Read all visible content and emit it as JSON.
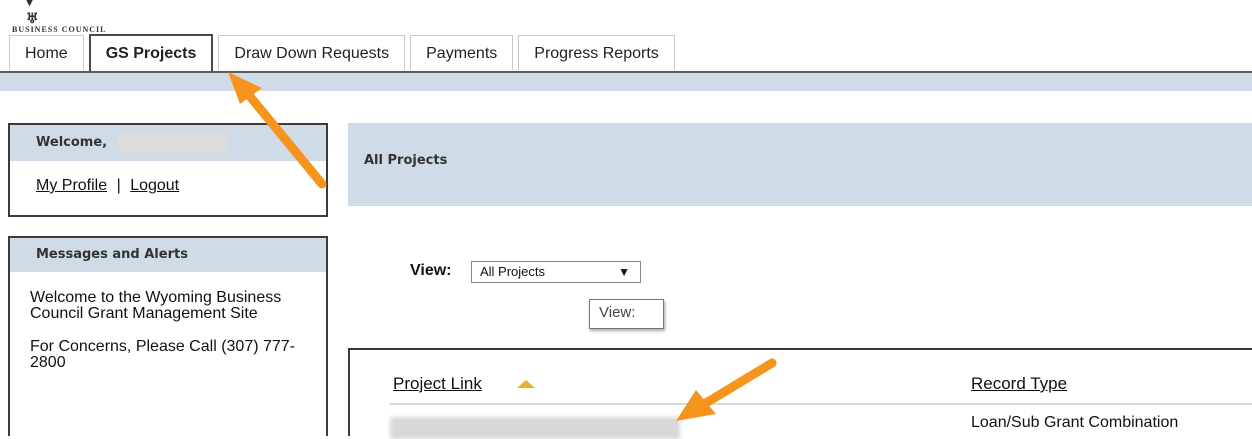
{
  "logo": {
    "text": "BUSINESS COUNCIL"
  },
  "tabs": [
    {
      "label": "Home"
    },
    {
      "label": "GS Projects"
    },
    {
      "label": "Draw Down Requests"
    },
    {
      "label": "Payments"
    },
    {
      "label": "Progress Reports"
    }
  ],
  "sidebar": {
    "welcome_title": "Welcome,",
    "my_profile": "My Profile",
    "separator": "|",
    "logout": "Logout",
    "messages_title": "Messages and Alerts",
    "message1": "Welcome to the Wyoming Business Council Grant Management Site",
    "message2": "For Concerns, Please Call (307) 777-2800"
  },
  "main": {
    "section_title": "All Projects",
    "view_label": "View:",
    "view_selected": "All Projects",
    "tooltip": "View:",
    "table": {
      "col1": "Project Link",
      "col2": "Record Type",
      "row1_record_type": "Loan/Sub Grant Combination"
    }
  },
  "colors": {
    "header_blue": "#cfdbe6",
    "arrow_orange": "#f7941d",
    "sort_gold": "#e7b12b"
  }
}
